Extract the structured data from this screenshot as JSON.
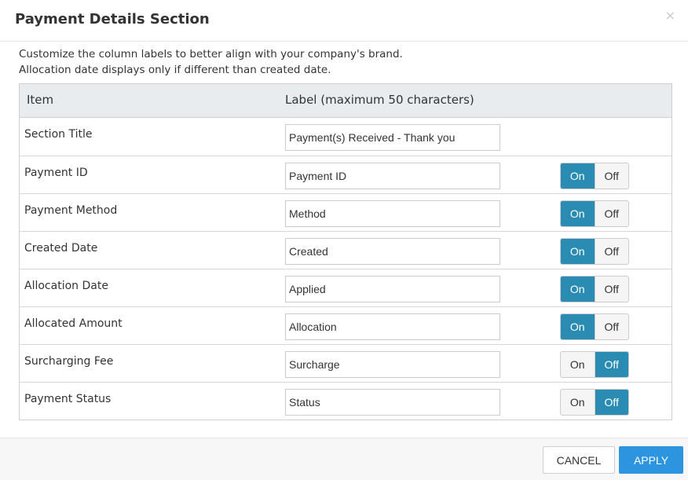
{
  "dialog": {
    "title": "Payment Details Section",
    "close_icon": "×",
    "description": [
      "Customize the column labels to better align with your company's brand.",
      "Allocation date displays only if different than created date."
    ]
  },
  "table": {
    "headers": {
      "item": "Item",
      "label": "Label (maximum 50 characters)"
    },
    "rows": [
      {
        "item": "Section Title",
        "value": "Payment(s) Received - Thank you",
        "toggle": null
      },
      {
        "item": "Payment ID",
        "value": "Payment ID",
        "toggle": "On"
      },
      {
        "item": "Payment Method",
        "value": "Method",
        "toggle": "On"
      },
      {
        "item": "Created Date",
        "value": "Created",
        "toggle": "On"
      },
      {
        "item": "Allocation Date",
        "value": "Applied",
        "toggle": "On"
      },
      {
        "item": "Allocated Amount",
        "value": "Allocation",
        "toggle": "On"
      },
      {
        "item": "Surcharging Fee",
        "value": "Surcharge",
        "toggle": "Off"
      },
      {
        "item": "Payment Status",
        "value": "Status",
        "toggle": "Off"
      }
    ],
    "toggle_labels": {
      "on": "On",
      "off": "Off"
    }
  },
  "footer": {
    "cancel_label": "CANCEL",
    "apply_label": "APPLY"
  },
  "colors": {
    "toggle_active": "#2b8cb3",
    "apply_button": "#2d94e0"
  }
}
